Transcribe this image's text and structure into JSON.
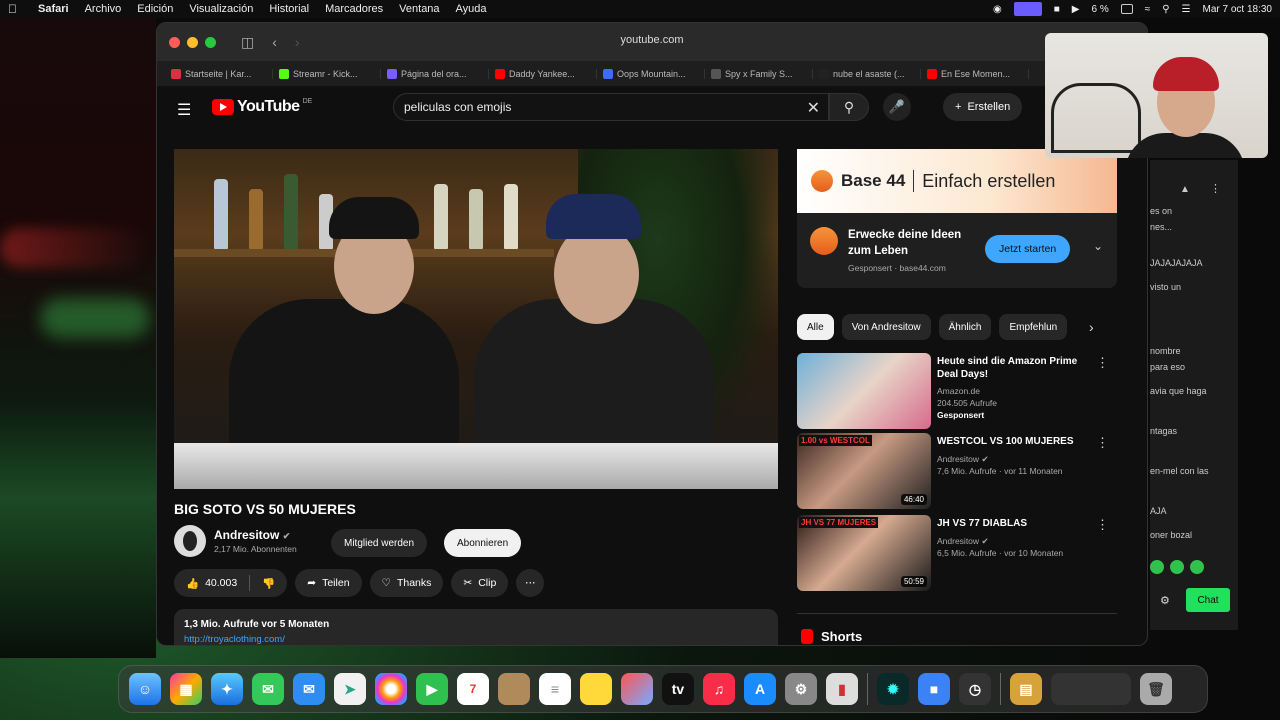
{
  "menubar": {
    "app": "Safari",
    "items": [
      "Archivo",
      "Edición",
      "Visualización",
      "Historial",
      "Marcadores",
      "Ventana",
      "Ayuda"
    ],
    "battery": "6 %",
    "clock": "Mar 7 oct 18:30"
  },
  "browser": {
    "url": "youtube.com",
    "tabs": [
      {
        "label": "Startseite | Kar...",
        "color": "#e03040"
      },
      {
        "label": "Streamr - Kick...",
        "color": "#53fc18"
      },
      {
        "label": "Página del ora...",
        "color": "#7b5cff"
      },
      {
        "label": "Daddy Yankee...",
        "color": "#ff0000"
      },
      {
        "label": "Oops Mountain...",
        "color": "#3b6cff"
      },
      {
        "label": "Spy x Family S...",
        "color": "#555555"
      },
      {
        "label": "nube el asaste (...",
        "color": "#222222"
      },
      {
        "label": "En Ese Momen...",
        "color": "#ff0000"
      }
    ]
  },
  "youtube": {
    "logo_text": "YouTube",
    "logo_country": "DE",
    "search_query": "peliculas con emojis",
    "create_label": "Erstellen",
    "video": {
      "title": "BIG SOTO VS 50 MUJERES",
      "channel": "Andresitow",
      "subscribers": "2,17 Mio. Abonnenten",
      "member_label": "Mitglied werden",
      "subscribe_label": "Abonnieren",
      "likes": "40.003",
      "share_label": "Teilen",
      "thanks_label": "Thanks",
      "clip_label": "Clip",
      "views_line": "1,3 Mio. Aufrufe  vor 5 Monaten",
      "desc_link": "http://troyaclothing.com/"
    },
    "ad": {
      "brand": "Base 44",
      "tagline": "Einfach erstellen",
      "headline": "Erwecke deine Ideen zum Leben",
      "sponsored": "Gesponsert",
      "domain": "base44.com",
      "cta": "Jetzt starten"
    },
    "chips": [
      "Alle",
      "Von Andresitow",
      "Ähnlich",
      "Empfehlun"
    ],
    "recommendations": [
      {
        "title": "Heute sind die Amazon Prime Deal Days!",
        "channel": "Amazon.de",
        "meta": "204.505 Aufrufe",
        "extra": "Gesponsert",
        "duration": ""
      },
      {
        "title": "WESTCOL VS 100 MUJERES",
        "channel": "Andresitow",
        "meta": "7,6 Mio. Aufrufe · vor 11 Monaten",
        "extra": "",
        "duration": "46:40"
      },
      {
        "title": "JH VS 77 DIABLAS",
        "channel": "Andresitow",
        "meta": "6,5 Mio. Aufrufe · vor 10 Monaten",
        "extra": "",
        "duration": "50:59"
      }
    ],
    "thumb_captions": [
      "1.00 vs WESTCOL",
      "JH VS 77 MUJERES"
    ],
    "shorts_label": "Shorts"
  },
  "chat": {
    "lines": [
      "es on",
      "nes...",
      "JAJAJAJAJA",
      "visto un",
      "nombre",
      "para eso",
      "avia que haga",
      "ntagas",
      "en-mel con las",
      "AJA",
      "oner bozal"
    ],
    "chat_button": "Chat"
  },
  "colors": {
    "yt_red": "#ff0000",
    "accent_blue": "#3ea6ff",
    "kick_green": "#20e05c"
  }
}
